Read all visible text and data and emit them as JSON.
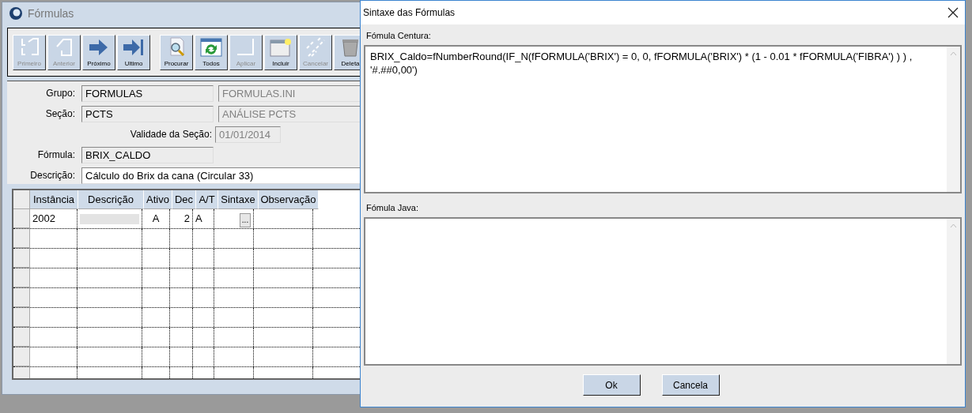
{
  "main_window": {
    "title": "Fórmulas",
    "toolbar": [
      {
        "label": "Primeiro",
        "kind": "first",
        "disabled": true
      },
      {
        "label": "Anterior",
        "kind": "prev",
        "disabled": true
      },
      {
        "label": "Próximo",
        "kind": "next",
        "disabled": false
      },
      {
        "label": "Ultimo",
        "kind": "last",
        "disabled": false
      },
      {
        "label": "Procurar",
        "kind": "search",
        "disabled": false
      },
      {
        "label": "Todos",
        "kind": "refresh",
        "disabled": false
      },
      {
        "label": "Aplicar",
        "kind": "apply",
        "disabled": true
      },
      {
        "label": "Incluir",
        "kind": "new",
        "disabled": false
      },
      {
        "label": "Cancelar",
        "kind": "cancel",
        "disabled": true
      },
      {
        "label": "Deleta",
        "kind": "delete",
        "disabled": false
      }
    ],
    "form": {
      "grupo": {
        "label": "Grupo:",
        "value": "FORMULAS",
        "description": "FORMULAS.INI"
      },
      "secao": {
        "label": "Seção:",
        "value": "PCTS",
        "description": "ANÁLISE PCTS"
      },
      "validade": {
        "label": "Validade da Seção:",
        "value": "01/01/2014"
      },
      "formula": {
        "label": "Fórmula:",
        "value": "BRIX_CALDO"
      },
      "descricao": {
        "label": "Descrição:",
        "value": "Cálculo do Brix da cana (Circular 33)"
      }
    },
    "grid": {
      "columns": [
        "Instância",
        "Descrição",
        "Ativo",
        "Dec",
        "A/T",
        "Sintaxe",
        "Observação"
      ],
      "rows": [
        {
          "instancia": "2002",
          "ativo": "A",
          "dec": "2",
          "at": "A",
          "sintaxe_button": "..."
        }
      ]
    }
  },
  "dialog": {
    "title": "Sintaxe das Fórmulas",
    "centura": {
      "label": "Fómula Centura:",
      "value": "BRIX_Caldo=fNumberRound(IF_N(fFORMULA('BRIX') = 0, 0, fFORMULA('BRIX') * (1 - 0.01 * fFORMULA('FIBRA') ) ) , '#.##0,00')"
    },
    "java": {
      "label": "Fómula Java:"
    },
    "buttons": [
      "Ok",
      "Cancela"
    ]
  }
}
